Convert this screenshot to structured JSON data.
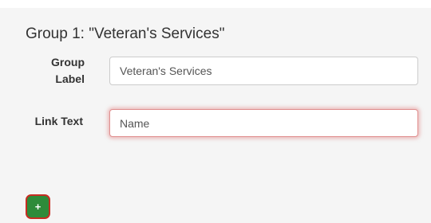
{
  "group": {
    "title": "Group 1: \"Veteran's Services\""
  },
  "fields": {
    "group_label": {
      "label": "Group Label",
      "value": "Veteran's Services"
    },
    "link_text": {
      "label": "Link Text",
      "value": "Name"
    }
  },
  "add_button": {
    "label": "+",
    "icon": "plus-icon"
  },
  "colors": {
    "add_button_fill": "#2e8b3a",
    "add_button_border": "#c62d22",
    "error_glow": "#e08f8f"
  }
}
